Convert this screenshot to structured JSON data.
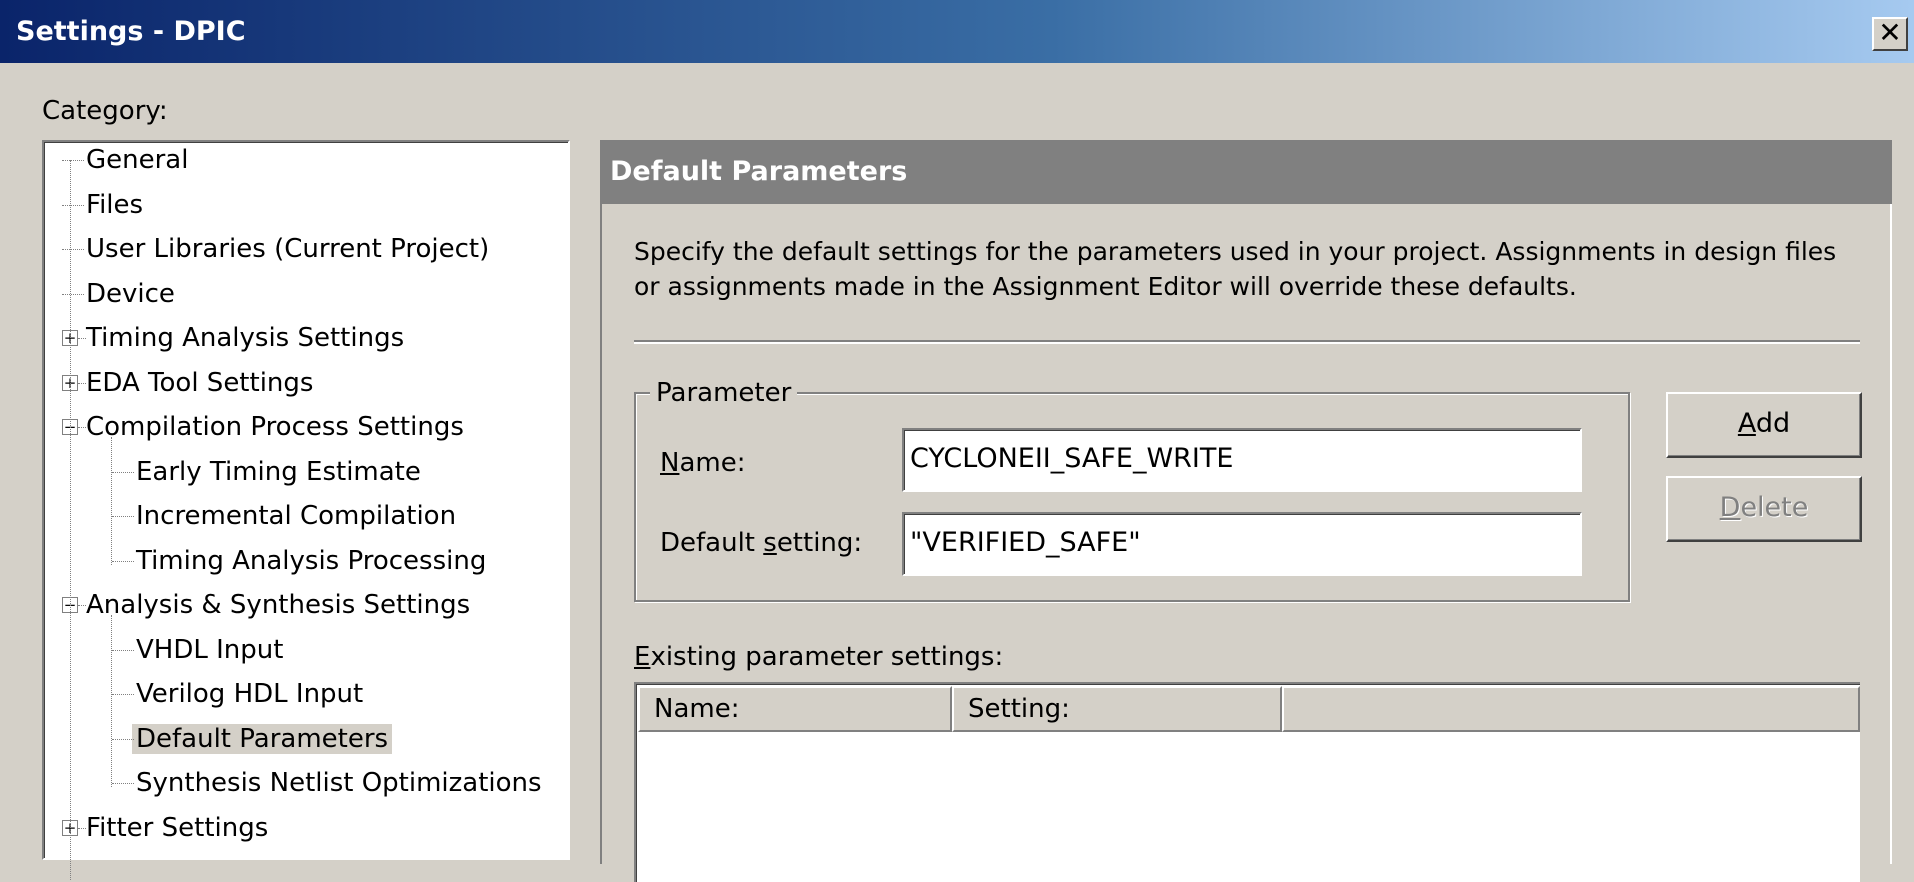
{
  "window": {
    "title": "Settings - DPIC",
    "close_glyph": "✕"
  },
  "category_label": "Category:",
  "tree": {
    "items": [
      {
        "label": "General",
        "level": 0,
        "expander": null
      },
      {
        "label": "Files",
        "level": 0,
        "expander": null
      },
      {
        "label": "User Libraries (Current Project)",
        "level": 0,
        "expander": null
      },
      {
        "label": "Device",
        "level": 0,
        "expander": null
      },
      {
        "label": "Timing Analysis Settings",
        "level": 0,
        "expander": "+"
      },
      {
        "label": "EDA Tool Settings",
        "level": 0,
        "expander": "+"
      },
      {
        "label": "Compilation Process Settings",
        "level": 0,
        "expander": "−"
      },
      {
        "label": "Early Timing Estimate",
        "level": 1,
        "expander": null
      },
      {
        "label": "Incremental Compilation",
        "level": 1,
        "expander": null
      },
      {
        "label": "Timing Analysis Processing",
        "level": 1,
        "expander": null
      },
      {
        "label": "Analysis & Synthesis Settings",
        "level": 0,
        "expander": "−"
      },
      {
        "label": "VHDL Input",
        "level": 1,
        "expander": null
      },
      {
        "label": "Verilog HDL Input",
        "level": 1,
        "expander": null
      },
      {
        "label": "Default Parameters",
        "level": 1,
        "expander": null,
        "selected": true
      },
      {
        "label": "Synthesis Netlist Optimizations",
        "level": 1,
        "expander": null
      },
      {
        "label": "Fitter Settings",
        "level": 0,
        "expander": "+"
      }
    ]
  },
  "panel": {
    "title": "Default Parameters",
    "description": "Specify the default settings for the parameters used in your project.  Assignments in design files or assignments made in the Assignment Editor will override these defaults.",
    "group_label": "Parameter",
    "name_label_mnemonic": "N",
    "name_label_rest": "ame:",
    "name_value": "CYCLONEII_SAFE_WRITE",
    "default_label_pre": "Default ",
    "default_label_mnemonic": "s",
    "default_label_rest": "etting:",
    "default_value": "\"VERIFIED_SAFE\"",
    "add_mnemonic": "A",
    "add_rest": "dd",
    "delete_mnemonic": "D",
    "delete_rest": "elete",
    "existing_mnemonic": "E",
    "existing_rest": "xisting parameter settings:",
    "columns": [
      "Name:",
      "Setting:",
      ""
    ]
  }
}
